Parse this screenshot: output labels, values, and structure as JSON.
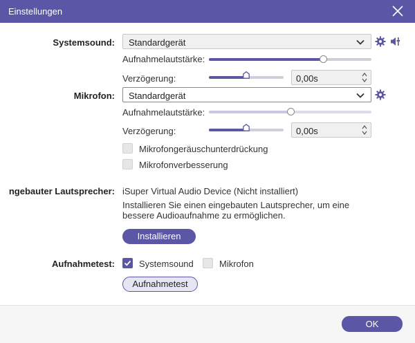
{
  "window": {
    "title": "Einstellungen"
  },
  "systemsound": {
    "label": "Systemsound:",
    "device": "Standardgerät",
    "volume_label": "Aufnahmelautstärke:",
    "volume_level": 0.7,
    "delay_label": "Verzögerung:",
    "delay_level": 0.5,
    "delay_value": "0,00s"
  },
  "mikrofon": {
    "label": "Mikrofon:",
    "device": "Standardgerät",
    "volume_label": "Aufnahmelautstärke:",
    "volume_level": 0.5,
    "delay_label": "Verzögerung:",
    "delay_level": 0.5,
    "delay_value": "0,00s",
    "noise_label": "Mikrofongeräuschunterdrückung",
    "noise_checked": false,
    "enhance_label": "Mikrofonverbesserung",
    "enhance_checked": false
  },
  "speaker": {
    "label": "ngebauter Lautsprecher:",
    "status": "iSuper Virtual Audio Device (Nicht installiert)",
    "description_line1": "Installieren Sie einen eingebauten Lautsprecher, um eine",
    "description_line2": "bessere Audioaufnahme zu ermöglichen.",
    "install_button": "Installieren"
  },
  "test": {
    "label": "Aufnahmetest:",
    "systemsound_label": "Systemsound",
    "systemsound_checked": true,
    "mikrofon_label": "Mikrofon",
    "mikrofon_checked": false,
    "test_button": "Aufnahmetest"
  },
  "footer": {
    "ok_button": "OK"
  },
  "colors": {
    "accent": "#5b56a6",
    "titlebar": "#5b56a6",
    "track": "#cfcfdc"
  }
}
